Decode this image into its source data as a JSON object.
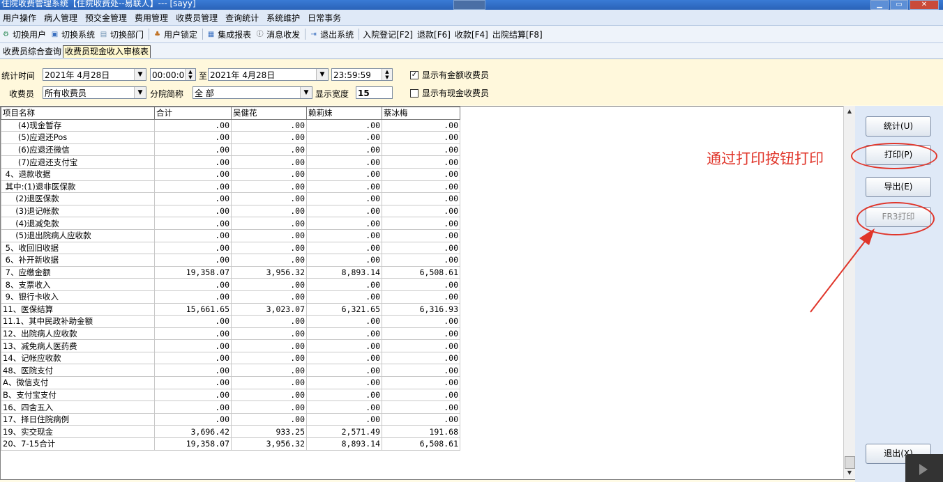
{
  "window": {
    "title": "住院收费管理系统【住院收费处--易联人】--- [sayy]",
    "controls": [
      "▁",
      "▭",
      "✕"
    ]
  },
  "menu": [
    "用户操作",
    "病人管理",
    "预交金管理",
    "费用管理",
    "收费员管理",
    "查询统计",
    "系统维护",
    "日常事务"
  ],
  "toolbar": {
    "items": [
      {
        "label": "切换用户",
        "icon": "switch-user-icon",
        "glyph": "⚙",
        "color": "#2e8b57"
      },
      {
        "label": "切换系统",
        "icon": "switch-system-icon",
        "glyph": "▣",
        "color": "#3a70c0"
      },
      {
        "label": "切换部门",
        "icon": "switch-dept-icon",
        "glyph": "▤",
        "color": "#6a8fb0"
      },
      {
        "label": "用户锁定",
        "icon": "lock-user-icon",
        "glyph": "♣",
        "color": "#c07020"
      },
      {
        "label": "集成报表",
        "icon": "report-icon",
        "glyph": "▦",
        "color": "#3a70c0"
      },
      {
        "label": "消息收发",
        "icon": "message-icon",
        "glyph": "ⓘ",
        "color": "#333"
      },
      {
        "label": "退出系统",
        "icon": "exit-icon",
        "glyph": "⇥",
        "color": "#3a70c0"
      }
    ],
    "shortcuts": [
      "入院登记[F2]",
      "退款[F6]",
      "收款[F4]",
      "出院结算[F8]"
    ]
  },
  "tabs": [
    "收费员综合查询",
    "收费员现金收入审核表"
  ],
  "filters": {
    "time_label": "统计时间",
    "date_from": "2021年 4月28日",
    "time_from": "00:00:00",
    "to_label": "至",
    "date_to": "2021年 4月28日",
    "time_to": "23:59:59",
    "cashier_label": "收费员",
    "cashier_value": "所有收费员",
    "branch_label": "分院简称",
    "branch_value": "全 部",
    "width_label": "显示宽度",
    "width_value": "15",
    "chk_amount_label": "显示有金额收费员",
    "chk_amount_checked": true,
    "chk_cash_label": "显示有现金收费员",
    "chk_cash_checked": false
  },
  "grid": {
    "columns": [
      "项目名称",
      "合计",
      "吴健花",
      "赖莉妹",
      "蔡冰梅"
    ],
    "rows": [
      [
        "      (4)现金暂存",
        ".00",
        ".00",
        ".00",
        ".00"
      ],
      [
        "      (5)应退还Pos",
        ".00",
        ".00",
        ".00",
        ".00"
      ],
      [
        "      (6)应退还微信",
        ".00",
        ".00",
        ".00",
        ".00"
      ],
      [
        "      (7)应退还支付宝",
        ".00",
        ".00",
        ".00",
        ".00"
      ],
      [
        " 4、退款收据",
        ".00",
        ".00",
        ".00",
        ".00"
      ],
      [
        " 其中:(1)退非医保款",
        ".00",
        ".00",
        ".00",
        ".00"
      ],
      [
        "     (2)退医保款",
        ".00",
        ".00",
        ".00",
        ".00"
      ],
      [
        "     (3)退记帐款",
        ".00",
        ".00",
        ".00",
        ".00"
      ],
      [
        "     (4)退减免款",
        ".00",
        ".00",
        ".00",
        ".00"
      ],
      [
        "     (5)退出院病人应收款",
        ".00",
        ".00",
        ".00",
        ".00"
      ],
      [
        " 5、收回旧收据",
        ".00",
        ".00",
        ".00",
        ".00"
      ],
      [
        " 6、补开新收据",
        ".00",
        ".00",
        ".00",
        ".00"
      ],
      [
        " 7、应缴金额",
        "19,358.07",
        "3,956.32",
        "8,893.14",
        "6,508.61"
      ],
      [
        " 8、支票收入",
        ".00",
        ".00",
        ".00",
        ".00"
      ],
      [
        " 9、银行卡收入",
        ".00",
        ".00",
        ".00",
        ".00"
      ],
      [
        "11、医保结算",
        "15,661.65",
        "3,023.07",
        "6,321.65",
        "6,316.93"
      ],
      [
        "11.1、其中民政补助金额",
        ".00",
        ".00",
        ".00",
        ".00"
      ],
      [
        "12、出院病人应收款",
        ".00",
        ".00",
        ".00",
        ".00"
      ],
      [
        "13、减免病人医药费",
        ".00",
        ".00",
        ".00",
        ".00"
      ],
      [
        "14、记帐应收款",
        ".00",
        ".00",
        ".00",
        ".00"
      ],
      [
        "48、医院支付",
        ".00",
        ".00",
        ".00",
        ".00"
      ],
      [
        "A、微信支付",
        ".00",
        ".00",
        ".00",
        ".00"
      ],
      [
        "B、支付宝支付",
        ".00",
        ".00",
        ".00",
        ".00"
      ],
      [
        "16、四舍五入",
        ".00",
        ".00",
        ".00",
        ".00"
      ],
      [
        "17、择日住院病例",
        ".00",
        ".00",
        ".00",
        ".00"
      ],
      [
        "19、实交现金",
        "3,696.42",
        "933.25",
        "2,571.49",
        "191.68"
      ],
      [
        "20、7-15合计",
        "19,358.07",
        "3,956.32",
        "8,893.14",
        "6,508.61"
      ]
    ]
  },
  "side_buttons": {
    "stat": "统计(U)",
    "print": "打印(P)",
    "export": "导出(E)",
    "frs_print": "FR3打印",
    "exit": "退出(X)"
  },
  "annotation": {
    "text": "通过打印按钮打印",
    "color": "#e0352a"
  }
}
